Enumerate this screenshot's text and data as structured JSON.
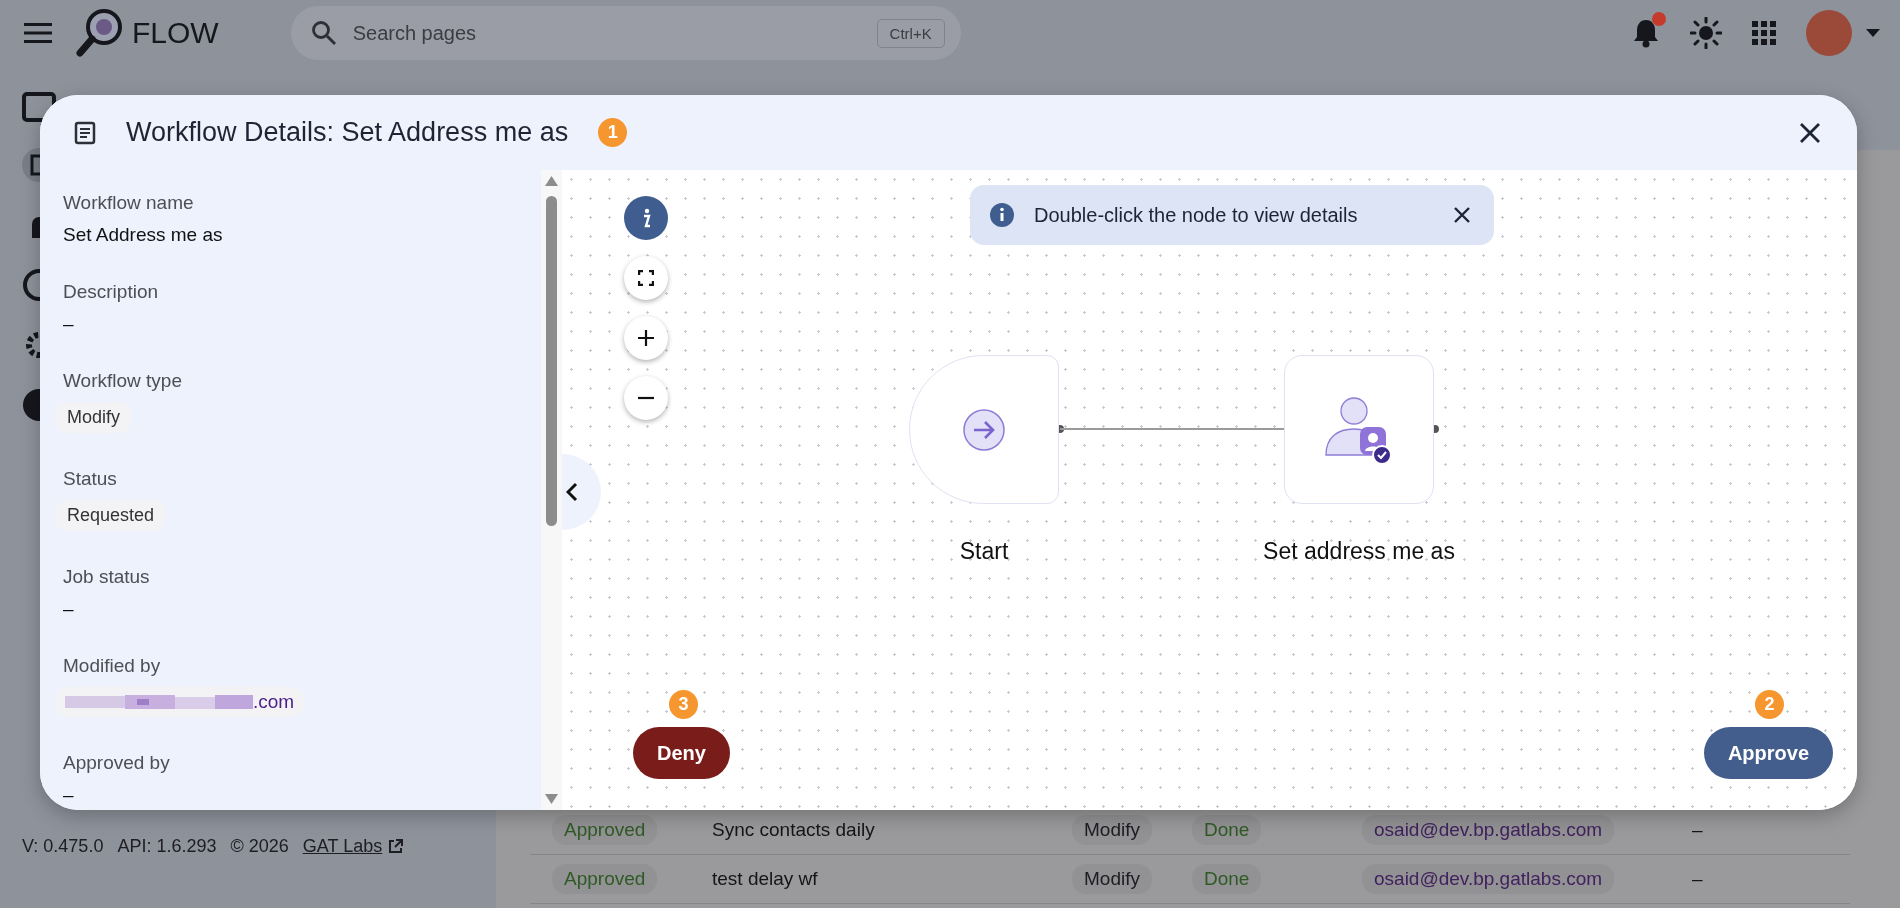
{
  "header": {
    "app_name": "FLOW",
    "search": {
      "placeholder": "Search pages",
      "shortcut": "Ctrl+K"
    },
    "notifications_unread": true
  },
  "table_rows": [
    {
      "status": "Approved",
      "name": "Sync contacts daily",
      "type": "Modify",
      "job_status": "Done",
      "modified_by": "osaid@dev.bp.gatlabs.com",
      "approved_by": "–"
    },
    {
      "status": "Approved",
      "name": "test delay wf",
      "type": "Modify",
      "job_status": "Done",
      "modified_by": "osaid@dev.bp.gatlabs.com",
      "approved_by": "–"
    }
  ],
  "footer": {
    "version": "V: 0.475.0",
    "api": "API: 1.6.293",
    "copyright": "© 2026",
    "link": "GAT Labs"
  },
  "modal": {
    "title": "Workflow Details: Set Address me as",
    "badge": "1",
    "fields": [
      {
        "label": "Workflow name",
        "value": "Set Address me as",
        "kind": "text"
      },
      {
        "label": "Description",
        "value": "–",
        "kind": "text"
      },
      {
        "label": "Workflow type",
        "value": "Modify",
        "kind": "chip"
      },
      {
        "label": "Status",
        "value": "Requested",
        "kind": "chip"
      },
      {
        "label": "Job status",
        "value": "–",
        "kind": "text"
      },
      {
        "label": "Modified by",
        "value": ".com",
        "kind": "email"
      },
      {
        "label": "Approved by",
        "value": "–",
        "kind": "text"
      }
    ],
    "hint": "Double-click the node to view details",
    "nodes": [
      {
        "label": "Start",
        "kind": "start"
      },
      {
        "label": "Set address me as",
        "kind": "task"
      }
    ],
    "buttons": [
      {
        "label": "Deny",
        "kind": "deny",
        "badge": "3"
      },
      {
        "label": "Approve",
        "kind": "approve",
        "badge": "2"
      }
    ]
  }
}
